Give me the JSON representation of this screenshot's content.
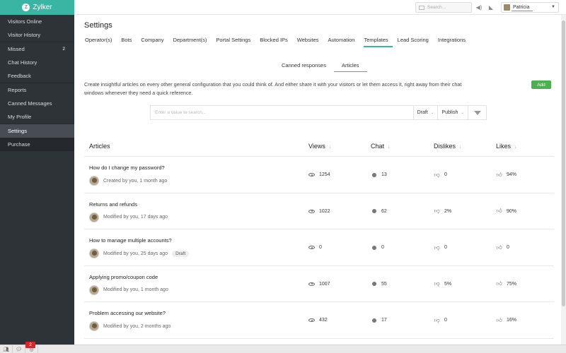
{
  "brand": {
    "name": "Zylker",
    "logo_letter": "Z"
  },
  "sidebar": {
    "items": [
      {
        "label": "Visitors Online",
        "count": ""
      },
      {
        "label": "Visitor History",
        "count": ""
      },
      {
        "label": "Missed",
        "count": "2"
      },
      {
        "label": "Chat History",
        "count": ""
      },
      {
        "label": "Feedback",
        "count": ""
      },
      {
        "label": "Reports",
        "count": ""
      },
      {
        "label": "Canned Messages",
        "count": ""
      },
      {
        "label": "My Profile",
        "count": ""
      },
      {
        "label": "Settings",
        "count": ""
      },
      {
        "label": "Purchase",
        "count": ""
      }
    ]
  },
  "topbar": {
    "search_placeholder": "Search...",
    "user_name": "Patricia"
  },
  "page": {
    "title": "Settings",
    "tabs": [
      "Operator(s)",
      "Bots",
      "Company",
      "Department(s)",
      "Portal Settings",
      "Blocked IPs",
      "Websites",
      "Automation",
      "Templates",
      "Lead Scoring",
      "Integrations"
    ],
    "active_tab": "Templates",
    "subtabs": [
      "Canned responses",
      "Articles"
    ],
    "active_subtab": "Articles",
    "description": "Create insightful articles on every other general configuration that you could think of. And either share it with your visitors or let them access it, right away from their chat windows whenever they need a quick reference.",
    "add_label": "Add",
    "filter_placeholder": "Enter a value to search...",
    "filter_status": "Draft",
    "filter_publish": "Publish"
  },
  "table": {
    "headers": {
      "articles": "Articles",
      "views": "Views",
      "chat": "Chat",
      "dislikes": "Dislikes",
      "likes": "Likes"
    },
    "rows": [
      {
        "title": "How do I change my password?",
        "meta": "Created by you, 1 month ago",
        "badge": "",
        "views": "1254",
        "chat": "13",
        "dislikes": "0",
        "likes": "94%"
      },
      {
        "title": "Returns and refunds",
        "meta": "Modified by you, 17 days ago",
        "badge": "",
        "views": "1022",
        "chat": "62",
        "dislikes": "2%",
        "likes": "90%"
      },
      {
        "title": "How to manage multiple accounts?",
        "meta": "Modified by you, 25 days ago",
        "badge": "Draft",
        "views": "0",
        "chat": "0",
        "dislikes": "0",
        "likes": "0"
      },
      {
        "title": "Applying promo/coupon code",
        "meta": "Modified by you, 1 month ago",
        "badge": "",
        "views": "1007",
        "chat": "55",
        "dislikes": "5%",
        "likes": "75%"
      },
      {
        "title": "Problem accessing our website?",
        "meta": "Modified by you, 2 months ago",
        "badge": "",
        "views": "432",
        "chat": "17",
        "dislikes": "0",
        "likes": "16%"
      }
    ]
  },
  "bottombar": {
    "badge_count": "2"
  },
  "colors": {
    "accent": "#3ab5a4",
    "sidebar": "#2e3338",
    "add_button": "#4caf50",
    "badge": "#d9262b"
  }
}
